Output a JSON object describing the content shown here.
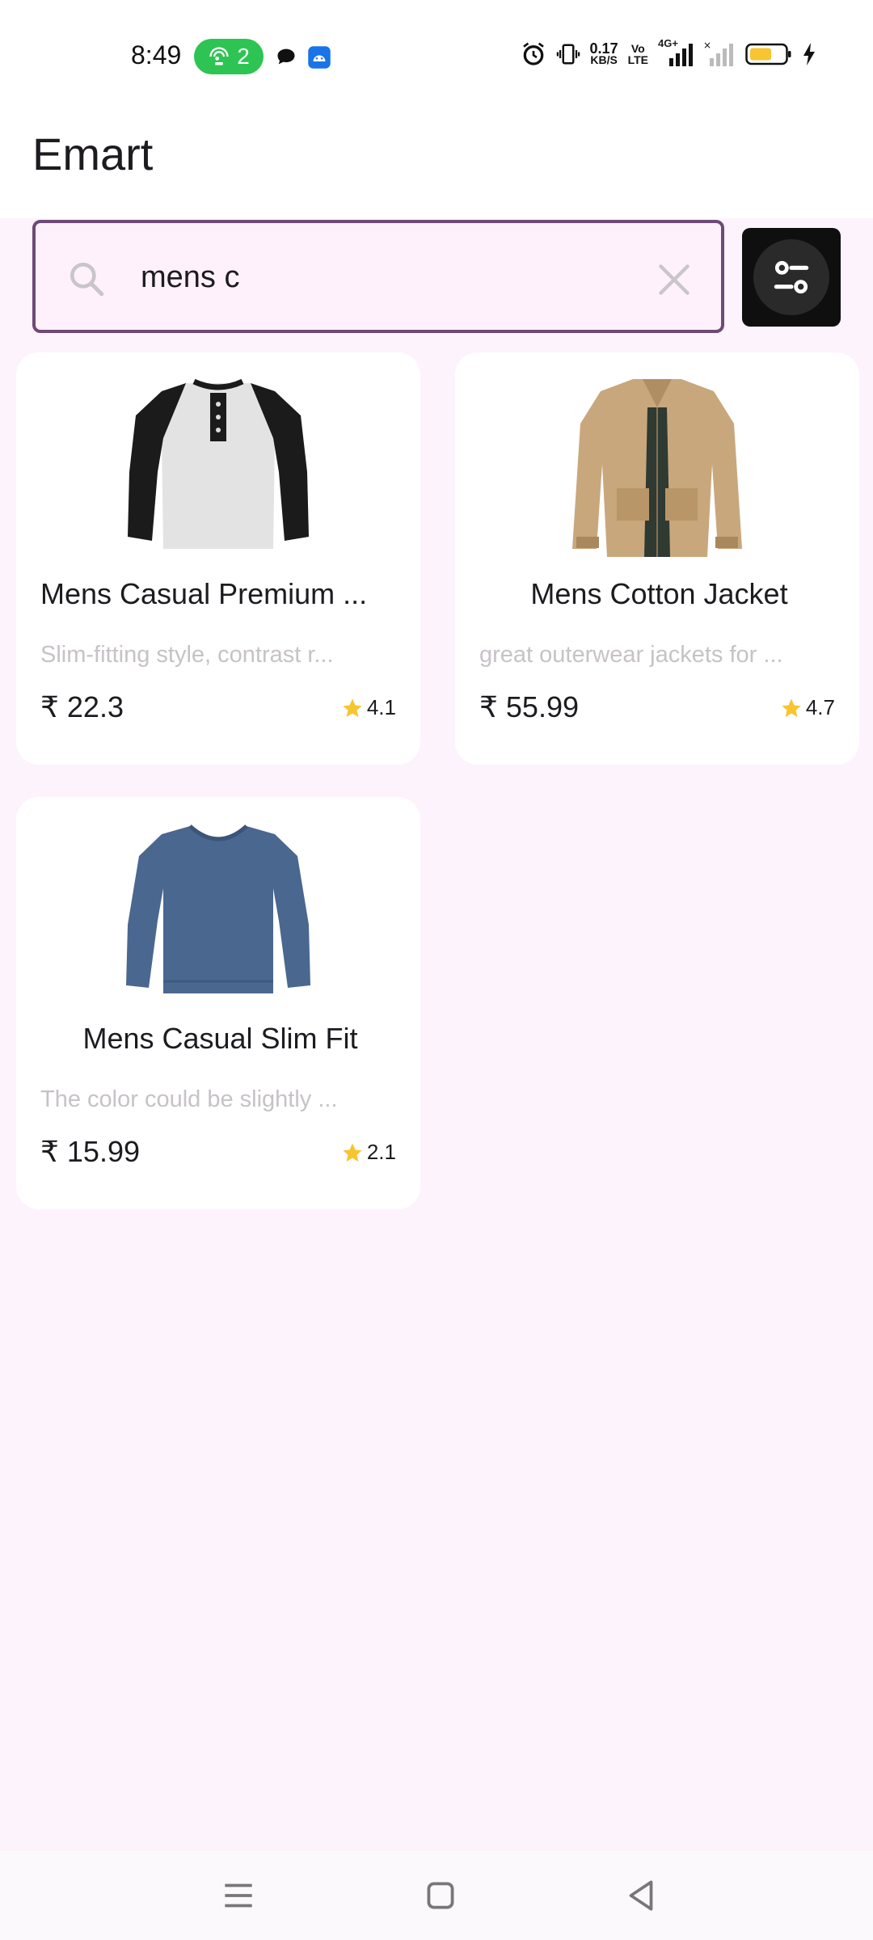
{
  "status_bar": {
    "time": "8:49",
    "hotspot_count": "2",
    "net_speed_value": "0.17",
    "net_speed_unit": "KB/S",
    "volte_line1": "Vo",
    "volte_line2": "LTE",
    "network_type": "4G+",
    "battery_color": "#f7c530"
  },
  "app_bar": {
    "title": "Emart"
  },
  "search": {
    "value": "mens c"
  },
  "products": [
    {
      "title": "Mens Casual Premium ...",
      "description": "Slim-fitting style, contrast r...",
      "price": "₹ 22.3",
      "rating": "4.1",
      "image": "henley-tshirt-image"
    },
    {
      "title": "Mens Cotton Jacket",
      "description": "great outerwear jackets for ...",
      "price": "₹ 55.99",
      "rating": "4.7",
      "image": "cotton-jacket-image"
    },
    {
      "title": "Mens Casual Slim Fit",
      "description": "The color could be slightly ...",
      "price": "₹ 15.99",
      "rating": "2.1",
      "image": "slim-fit-shirt-image"
    }
  ],
  "colors": {
    "background": "#fdf3fc",
    "search_border": "#6e4a77",
    "star": "#f7c530",
    "hotspot_pill": "#2ec453"
  }
}
